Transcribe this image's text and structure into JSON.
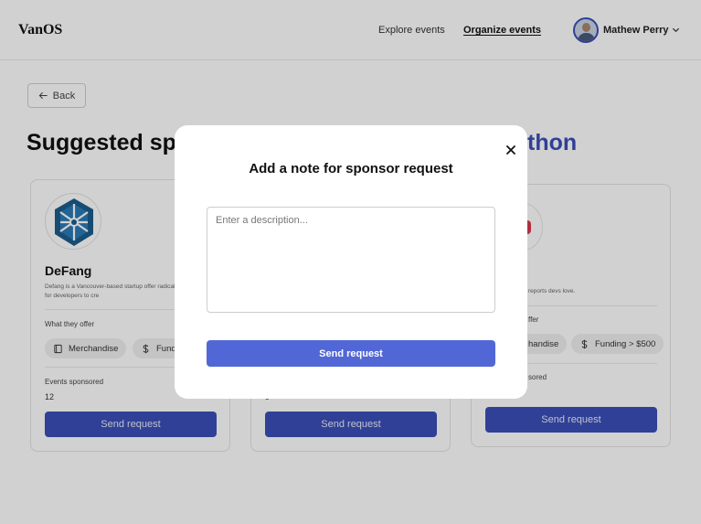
{
  "header": {
    "logo": "VanOS",
    "nav": {
      "explore": "Explore events",
      "organize": "Organize events"
    },
    "user": {
      "name": "Mathew Perry"
    }
  },
  "page": {
    "back_label": "Back",
    "heading_visible": "Suggested sp",
    "heading_accent": "thon"
  },
  "cards": [
    {
      "name": "DeFang",
      "description": "Defang is a Vancouver-based startup offer radically simpler way for developers to cre",
      "offer_label": "What they offer",
      "offers": [
        "Merchandise",
        "Fundir"
      ],
      "events_label": "Events sponsored",
      "events_count": "12",
      "button": "Send request"
    },
    {
      "events_count": "9",
      "button": "Send request"
    },
    {
      "description": "reports devs love.",
      "offer_label": "ffer",
      "offers": [
        "handise",
        "Funding > $500"
      ],
      "events_label": "sored",
      "button": "Send request"
    }
  ],
  "modal": {
    "title": "Add a note for sponsor request",
    "textarea_placeholder": "Enter a description...",
    "send_label": "Send request"
  },
  "colors": {
    "brand": "#3b4fb8",
    "modal_button": "#5267d6",
    "heading_accent": "#3b4fb8"
  },
  "icons": [
    "back-arrow-icon",
    "chevron-down-icon",
    "close-icon",
    "merchandise-icon",
    "dollar-icon"
  ]
}
